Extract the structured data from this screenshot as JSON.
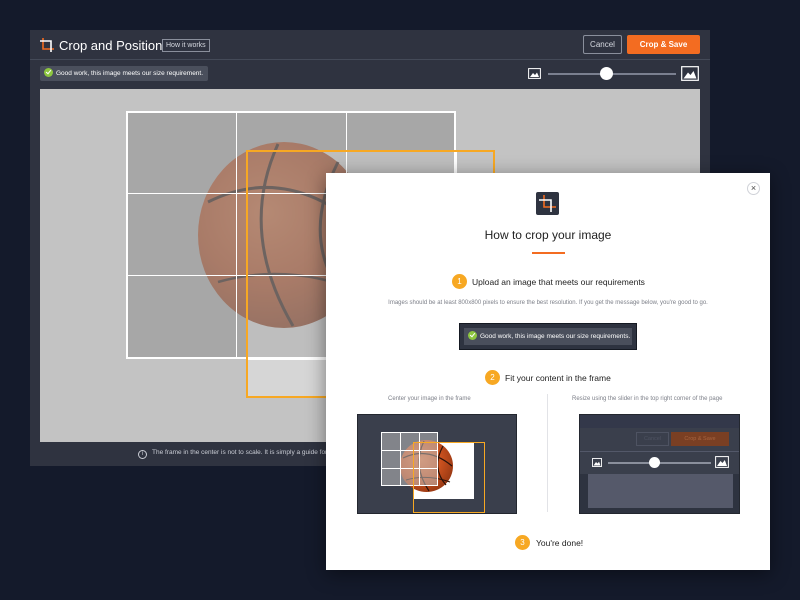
{
  "editor": {
    "title": "Crop and Position",
    "how_it_works_label": "How it works",
    "cancel_label": "Cancel",
    "save_label": "Crop & Save",
    "success_message": "Good work, this image meets our size requirement.",
    "footnote": "The frame in the center is not to scale. It is simply a guide for po",
    "icons": {
      "crop": "crop-icon",
      "zoom_out": "image-small-icon",
      "zoom_in": "image-large-icon",
      "info": "info-icon",
      "check": "check-icon"
    },
    "accent_color": "#f36c21",
    "frame_color": "#f7a823"
  },
  "modal": {
    "title": "How to crop your image",
    "close_icon": "close-icon",
    "steps": [
      {
        "number": "1",
        "label": "Upload an image that meets our requirements",
        "description": "Images should be at least 800x800 pixels to ensure the best resolution. If you get the message below, you're good to go.",
        "sample_message": "Good work, this image meets our size requirements."
      },
      {
        "number": "2",
        "label": "Fit your content in the frame",
        "left_caption": "Center your image in the frame",
        "right_caption": "Resize using the slider in the top right corner of the page",
        "mini_cancel_label": "Cancel",
        "mini_save_label": "Crop & Save"
      },
      {
        "number": "3",
        "label": "You're done!"
      }
    ]
  }
}
